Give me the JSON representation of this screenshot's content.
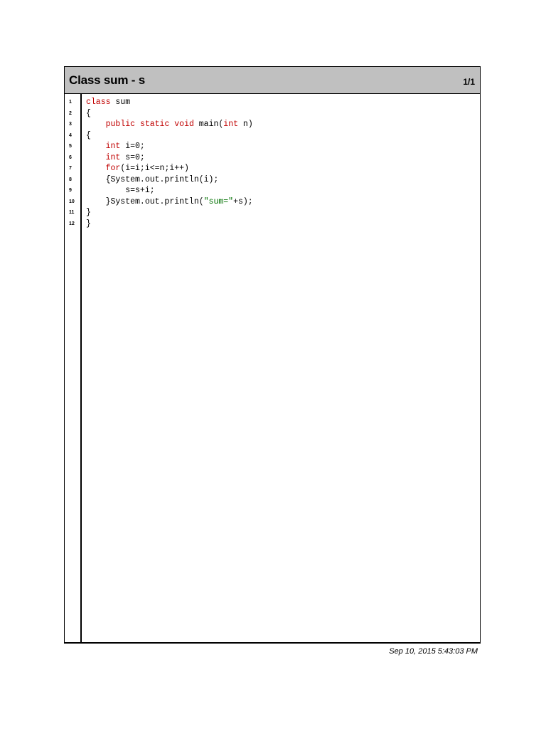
{
  "header": {
    "title": "Class sum - s",
    "page": "1/1"
  },
  "code": {
    "lines": [
      {
        "num": "1",
        "tokens": [
          {
            "t": "class",
            "k": "kw"
          },
          {
            "t": " sum",
            "k": ""
          }
        ]
      },
      {
        "num": "2",
        "tokens": [
          {
            "t": "{",
            "k": ""
          }
        ]
      },
      {
        "num": "3",
        "tokens": [
          {
            "t": "    ",
            "k": ""
          },
          {
            "t": "public",
            "k": "kw"
          },
          {
            "t": " ",
            "k": ""
          },
          {
            "t": "static",
            "k": "kw"
          },
          {
            "t": " ",
            "k": ""
          },
          {
            "t": "void",
            "k": "kw"
          },
          {
            "t": " main(",
            "k": ""
          },
          {
            "t": "int",
            "k": "kw"
          },
          {
            "t": " n)",
            "k": ""
          }
        ]
      },
      {
        "num": "4",
        "tokens": [
          {
            "t": "{",
            "k": ""
          }
        ]
      },
      {
        "num": "5",
        "tokens": [
          {
            "t": "    ",
            "k": ""
          },
          {
            "t": "int",
            "k": "kw"
          },
          {
            "t": " i=0;",
            "k": ""
          }
        ]
      },
      {
        "num": "6",
        "tokens": [
          {
            "t": "    ",
            "k": ""
          },
          {
            "t": "int",
            "k": "kw"
          },
          {
            "t": " s=0;",
            "k": ""
          }
        ]
      },
      {
        "num": "7",
        "tokens": [
          {
            "t": "    ",
            "k": ""
          },
          {
            "t": "for",
            "k": "kw"
          },
          {
            "t": "(i=i;i<=n;i++)",
            "k": ""
          }
        ]
      },
      {
        "num": "8",
        "tokens": [
          {
            "t": "    {System.out.println(i);",
            "k": ""
          }
        ]
      },
      {
        "num": "9",
        "tokens": [
          {
            "t": "        s=s+i;",
            "k": ""
          }
        ]
      },
      {
        "num": "10",
        "tokens": [
          {
            "t": "    }System.out.println(",
            "k": ""
          },
          {
            "t": "\"sum=\"",
            "k": "str"
          },
          {
            "t": "+s);",
            "k": ""
          }
        ]
      },
      {
        "num": "11",
        "tokens": [
          {
            "t": "}",
            "k": ""
          }
        ]
      },
      {
        "num": "12",
        "tokens": [
          {
            "t": "}",
            "k": ""
          }
        ]
      }
    ]
  },
  "footer": {
    "timestamp": "Sep 10, 2015 5:43:03 PM"
  },
  "colors": {
    "keyword": "#c00000",
    "string": "#007000",
    "header_bg": "#c0c0c0"
  }
}
